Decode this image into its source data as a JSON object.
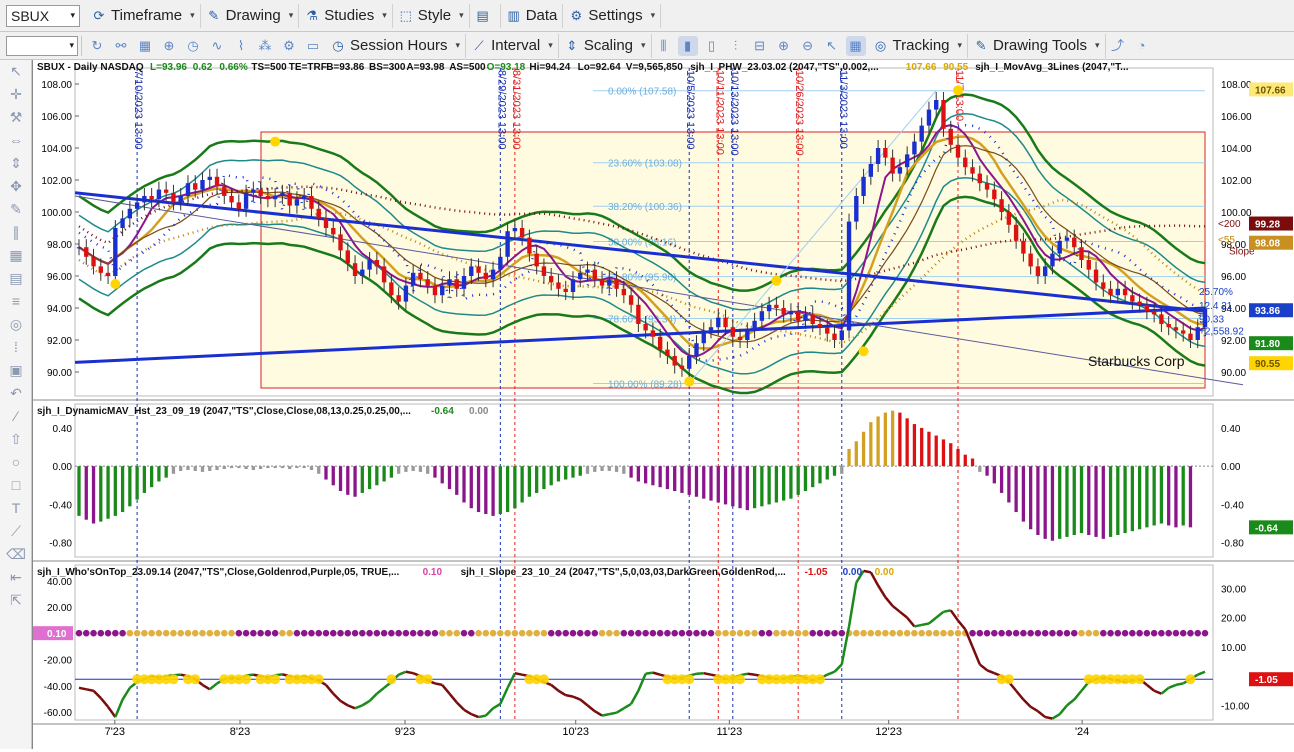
{
  "toolbar": {
    "symbol": "SBUX",
    "row1": [
      {
        "id": "timeframe",
        "label": "Timeframe",
        "icon": "timeframe-icon"
      },
      {
        "id": "drawing",
        "label": "Drawing",
        "icon": "drawing-icon"
      },
      {
        "id": "studies",
        "label": "Studies",
        "icon": "studies-icon"
      },
      {
        "id": "style",
        "label": "Style",
        "icon": "style-icon"
      },
      {
        "id": "data",
        "label": "Data",
        "icon": "data-icon"
      },
      {
        "id": "settings",
        "label": "Settings",
        "icon": "gear-icon"
      }
    ],
    "row2": [
      {
        "id": "session-hours",
        "label": "Session Hours",
        "icon": "clock-icon"
      },
      {
        "id": "interval",
        "label": "Interval",
        "icon": "interval-icon"
      },
      {
        "id": "scaling",
        "label": "Scaling",
        "icon": "scaling-icon"
      },
      {
        "id": "tracking",
        "label": "Tracking",
        "icon": "tracking-icon"
      },
      {
        "id": "drawing-tools",
        "label": "Drawing Tools",
        "icon": "drawing-tools-icon"
      }
    ]
  },
  "left_tools": [
    "cursor-icon",
    "crosshair-icon",
    "wrench-icon",
    "arrows-h-icon",
    "arrows-v-icon",
    "move-icon",
    "pen-icon",
    "bars-icon",
    "grid-icon",
    "table-icon",
    "lines-icon",
    "target-icon",
    "dots-icon",
    "image-icon",
    "undo-icon",
    "slash-icon",
    "arrow-up-icon",
    "circle-icon",
    "rectangle-icon",
    "text-icon",
    "ruler-icon",
    "erase-icon",
    "back-icon",
    "drag-icon"
  ],
  "chart_data": [
    {
      "type": "candlestick",
      "title": "SBUX - Daily NASDAQ",
      "header": [
        {
          "text": "SBUX - Daily  NASDAQ",
          "color": "#111"
        },
        {
          "text": "L=93.96",
          "color": "#1a8a1a"
        },
        {
          "text": "0.62",
          "color": "#1a8a1a"
        },
        {
          "text": "0.66%",
          "color": "#1a8a1a"
        },
        {
          "text": "TS=500",
          "color": "#111"
        },
        {
          "text": "TE=TRF",
          "color": "#111"
        },
        {
          "text": "B=93.86",
          "color": "#111"
        },
        {
          "text": "BS=300",
          "color": "#111"
        },
        {
          "text": "A=93.98",
          "color": "#111"
        },
        {
          "text": "AS=500",
          "color": "#111"
        },
        {
          "text": "O=93.18",
          "color": "#1a8a1a"
        },
        {
          "text": "Hi=94.24",
          "color": "#111"
        },
        {
          "text": "Lo=92.64",
          "color": "#111"
        },
        {
          "text": "V=9,565,850",
          "color": "#111"
        },
        {
          "text": "sjh_I_PHW_23.03.02 (2047,\"TS\",0.002,...",
          "color": "#111"
        },
        {
          "text": "107.66",
          "color": "#d9a800"
        },
        {
          "text": "90.55",
          "color": "#d9a800"
        },
        {
          "text": "sjh_I_MovAvg_3Lines (2047,\"T...",
          "color": "#111"
        }
      ],
      "ylim": [
        88.5,
        109
      ],
      "yticks": [
        90,
        92,
        94,
        96,
        98,
        100,
        102,
        104,
        106,
        108
      ],
      "ytick_labels": [
        "90.00",
        "92.00",
        "94.00",
        "96.00",
        "98.00",
        "100.00",
        "102.00",
        "104.00",
        "106.00",
        "108.00"
      ],
      "right_badges": [
        {
          "text": "107.66",
          "value": 107.66,
          "bg": "#fde87a",
          "fg": "#6b5500"
        },
        {
          "text": "99.28",
          "value": 99.28,
          "bg": "#7a0c0c",
          "fg": "#fff"
        },
        {
          "text": "98.08",
          "value": 98.08,
          "bg": "#c89020",
          "fg": "#fff"
        },
        {
          "text": "93.86",
          "value": 93.86,
          "bg": "#1a40c8",
          "fg": "#fff"
        },
        {
          "text": "91.80",
          "value": 91.8,
          "bg": "#1a8a1a",
          "fg": "#fff"
        },
        {
          "text": "90.55",
          "value": 90.55,
          "bg": "#ffd400",
          "fg": "#6b5500"
        }
      ],
      "annotations": [
        {
          "text": "<200",
          "value": 99.3,
          "color": "#7a0c0c"
        },
        {
          "text": "<55",
          "value": 98.3,
          "color": "#b8860b"
        },
        {
          "text": "Slope",
          "value": 97.6,
          "color": "#7a0c0c"
        },
        {
          "text": "25.70%",
          "value": 95.05,
          "color": "#1a40c8"
        },
        {
          "text": "12.4 21",
          "value": 94.2,
          "color": "#1a40c8"
        },
        {
          "text": "90.33",
          "value": 93.35,
          "color": "#1a40c8"
        },
        {
          "text": "+2,558.92",
          "value": 92.6,
          "color": "#1a40c8"
        },
        {
          "text": "Starbucks Corp",
          "value": 90.7,
          "color": "#111"
        }
      ],
      "fib_levels": [
        {
          "text": "0.00% (107.58)",
          "value": 107.58
        },
        {
          "text": "23.60% (103.08)",
          "value": 103.08
        },
        {
          "text": "38.20% (100.36)",
          "value": 100.36
        },
        {
          "text": "50.00% (98.16)",
          "value": 98.16
        },
        {
          "text": "61.80% (95.96)",
          "value": 95.96
        },
        {
          "text": "78.60% (93.34)",
          "value": 93.34
        },
        {
          "text": "100.00% (89.28)",
          "value": 89.28
        }
      ],
      "vlines": [
        {
          "label": "7/10/2023 13:00",
          "x": 8,
          "style": "blue"
        },
        {
          "label": "8/29/2023 13:00",
          "x": 58,
          "style": "blue"
        },
        {
          "label": "8/31/2023 13:00",
          "x": 60,
          "style": "red"
        },
        {
          "label": "10/5/2023 13:00",
          "x": 84,
          "style": "blue"
        },
        {
          "label": "10/11/2023 13:00",
          "x": 88,
          "style": "red"
        },
        {
          "label": "10/13/2023 13:00",
          "x": 90,
          "style": "blue"
        },
        {
          "label": "10/26/2023 13:00",
          "x": 99,
          "style": "red"
        },
        {
          "label": "11/3/2023 13:00",
          "x": 105,
          "style": "blue"
        },
        {
          "label": "11/7 13:00",
          "x": 121,
          "style": "red"
        }
      ],
      "close": [
        97.8,
        97.2,
        96.6,
        96.2,
        96.0,
        99.0,
        99.6,
        100.2,
        100.6,
        101.0,
        100.8,
        101.4,
        101.2,
        100.6,
        101.0,
        101.8,
        101.4,
        102.0,
        102.2,
        101.6,
        101.0,
        100.6,
        100.2,
        101.2,
        101.4,
        101.0,
        100.8,
        101.0,
        101.2,
        100.4,
        100.8,
        101.0,
        100.2,
        99.6,
        99.0,
        98.6,
        97.6,
        96.8,
        96.0,
        96.4,
        97.0,
        96.6,
        95.6,
        94.8,
        94.4,
        95.4,
        96.2,
        95.8,
        95.4,
        94.8,
        95.4,
        95.8,
        95.2,
        96.0,
        96.6,
        96.2,
        95.8,
        96.4,
        97.2,
        98.8,
        99.0,
        98.4,
        97.4,
        96.6,
        96.0,
        95.6,
        95.2,
        95.0,
        95.8,
        96.2,
        96.4,
        95.8,
        95.4,
        95.8,
        95.2,
        94.8,
        94.2,
        93.0,
        92.6,
        92.2,
        91.4,
        91.0,
        90.4,
        90.2,
        91.0,
        91.8,
        92.6,
        92.8,
        93.4,
        92.8,
        92.2,
        92.0,
        92.6,
        93.2,
        93.8,
        94.2,
        94.0,
        93.6,
        93.8,
        93.2,
        93.6,
        93.0,
        92.8,
        92.4,
        92.0,
        92.6,
        99.4,
        101.0,
        102.2,
        103.0,
        104.0,
        103.4,
        102.4,
        102.8,
        103.6,
        104.4,
        105.4,
        106.4,
        107.0,
        105.2,
        104.2,
        103.4,
        102.8,
        102.4,
        101.8,
        101.4,
        100.8,
        100.0,
        99.2,
        98.2,
        97.4,
        96.6,
        96.0,
        96.6,
        97.4,
        98.2,
        98.4,
        97.8,
        97.0,
        96.4,
        95.6,
        95.2,
        94.8,
        95.2,
        94.8,
        94.4,
        94.2,
        93.8,
        93.6,
        93.0,
        92.8,
        92.6,
        92.4,
        92.0,
        92.8,
        93.96
      ]
    },
    {
      "type": "bar",
      "title": "sjh_I_DynamicMAV_Hst_23_09_19 (2047,\"TS\",Close,Close,08,13,0.25,0.25,00,...",
      "header_values": [
        {
          "text": "-0.64",
          "color": "#1a8a1a"
        },
        {
          "text": "0.00",
          "color": "#888"
        }
      ],
      "ylim": [
        -0.95,
        0.65
      ],
      "yticks": [
        -0.8,
        -0.4,
        0.0,
        0.4
      ],
      "ytick_labels": [
        "-0.80",
        "-0.40",
        "0.00",
        "0.40"
      ],
      "last_value_badge": {
        "text": "-0.64",
        "bg": "#1a8a1a",
        "fg": "#fff"
      },
      "values": [
        -0.52,
        -0.56,
        -0.6,
        -0.58,
        -0.55,
        -0.52,
        -0.48,
        -0.42,
        -0.35,
        -0.28,
        -0.22,
        -0.16,
        -0.12,
        -0.08,
        -0.05,
        -0.04,
        -0.05,
        -0.06,
        -0.05,
        -0.04,
        -0.03,
        -0.02,
        -0.02,
        -0.03,
        -0.04,
        -0.03,
        -0.02,
        -0.02,
        -0.02,
        -0.03,
        -0.02,
        -0.02,
        -0.04,
        -0.08,
        -0.14,
        -0.2,
        -0.26,
        -0.3,
        -0.32,
        -0.28,
        -0.24,
        -0.2,
        -0.16,
        -0.12,
        -0.08,
        -0.06,
        -0.05,
        -0.06,
        -0.08,
        -0.12,
        -0.18,
        -0.24,
        -0.3,
        -0.38,
        -0.44,
        -0.48,
        -0.5,
        -0.52,
        -0.5,
        -0.48,
        -0.44,
        -0.38,
        -0.32,
        -0.28,
        -0.24,
        -0.2,
        -0.16,
        -0.14,
        -0.12,
        -0.1,
        -0.08,
        -0.06,
        -0.05,
        -0.05,
        -0.06,
        -0.08,
        -0.12,
        -0.16,
        -0.18,
        -0.2,
        -0.22,
        -0.24,
        -0.26,
        -0.28,
        -0.3,
        -0.32,
        -0.34,
        -0.36,
        -0.38,
        -0.4,
        -0.42,
        -0.44,
        -0.46,
        -0.44,
        -0.42,
        -0.4,
        -0.38,
        -0.36,
        -0.34,
        -0.3,
        -0.26,
        -0.22,
        -0.18,
        -0.14,
        -0.1,
        -0.08,
        0.18,
        0.26,
        0.36,
        0.46,
        0.52,
        0.56,
        0.58,
        0.56,
        0.5,
        0.44,
        0.4,
        0.36,
        0.32,
        0.28,
        0.24,
        0.18,
        0.12,
        0.08,
        -0.06,
        -0.1,
        -0.18,
        -0.28,
        -0.38,
        -0.48,
        -0.58,
        -0.66,
        -0.72,
        -0.76,
        -0.78,
        -0.76,
        -0.74,
        -0.72,
        -0.7,
        -0.72,
        -0.74,
        -0.76,
        -0.74,
        -0.72,
        -0.7,
        -0.68,
        -0.66,
        -0.64,
        -0.62,
        -0.6,
        -0.62,
        -0.64,
        -0.62,
        -0.64
      ],
      "colors_legend": {
        "positive_up": "#d4a020",
        "positive": "#dd1111",
        "negative_up": "#1a8a1a",
        "negative": "#8b168b",
        "flat": "#999999"
      }
    },
    {
      "type": "line",
      "title": "sjh_I_Who'sOnTop_23.09.14 (2047,\"TS\",Close,Goldenrod,Purple,05, TRUE,...",
      "header_values": [
        {
          "text": "0.10",
          "color": "#e040a0"
        }
      ],
      "title2": "sjh_I_Slope_23_10_24 (2047,\"TS\",5,0,03,03,DarkGreen,GoldenRod,...",
      "header_values2": [
        {
          "text": "-1.05",
          "color": "#dd1111"
        },
        {
          "text": "0.00",
          "color": "#1a40c8"
        },
        {
          "text": "0.00",
          "color": "#d9a800"
        }
      ],
      "ylim_left": [
        -66,
        52
      ],
      "yticks_left": [
        -60,
        -40,
        -20,
        20,
        40
      ],
      "ytick_labels_left": [
        "-60.00",
        "-40.00",
        "-20.00",
        "20.00",
        "40.00"
      ],
      "left_badge": {
        "text": "0.10",
        "bg": "#e070d0",
        "fg": "#fff"
      },
      "ylim_right": [
        -15,
        38
      ],
      "yticks_right": [
        -10,
        10,
        20,
        30
      ],
      "ytick_labels_right": [
        "-10.00",
        "10.00",
        "20.00",
        "30.00"
      ],
      "right_badge": {
        "text": "-1.05",
        "bg": "#dd1111",
        "fg": "#fff"
      },
      "slope": [
        -4.0,
        -4.5,
        -5.0,
        -7.5,
        -10.5,
        -14.0,
        -8.0,
        -4.0,
        -2.0,
        -1.0,
        0.0,
        -0.5,
        0.0,
        0.3,
        0.5,
        0.0,
        -1.0,
        -3.0,
        -4.5,
        -2.5,
        -1.0,
        -0.5,
        -1.0,
        0.2,
        0.5,
        0.0,
        -0.5,
        0.3,
        0.6,
        0.0,
        -0.5,
        0.0,
        -0.8,
        -1.5,
        -3.0,
        -6.0,
        -8.5,
        -10.0,
        -11.0,
        -10.0,
        -8.5,
        -6.0,
        -4.0,
        -2.0,
        0.5,
        1.5,
        1.0,
        0.0,
        -1.5,
        -2.5,
        -3.0,
        -6.0,
        -9.0,
        -11.5,
        -13.0,
        -14.0,
        -13.5,
        -11.0,
        -9.5,
        -4.0,
        1.0,
        0.5,
        0.0,
        -1.0,
        -2.0,
        -3.0,
        -5.0,
        -6.5,
        -7.0,
        -8.0,
        -10.0,
        -12.0,
        -13.5,
        -13.0,
        -12.5,
        -11.0,
        -9.5,
        -5.0,
        0.8,
        1.2,
        0.5,
        -0.2,
        -0.8,
        -0.5,
        0.2,
        0.8,
        1.0,
        0.5,
        0.0,
        -1.0,
        -0.5,
        0.3,
        0.8,
        0.5,
        0.0,
        -0.5,
        -1.0,
        -0.8,
        -0.3,
        0.2,
        -0.5,
        -1.5,
        -0.8,
        0.5,
        1.5,
        4.0,
        17.0,
        32.0,
        36.0,
        35.5,
        31.0,
        27.0,
        24.0,
        22.0,
        20.0,
        17.0,
        17.5,
        18.0,
        20.0,
        22.0,
        22.5,
        19.0,
        16.0,
        10.0,
        4.0,
        2.0,
        1.0,
        0.0,
        -2.0,
        -5.0,
        -8.0,
        -10.5,
        -12.0,
        -14.0,
        -14.5,
        -13.0,
        -10.0,
        -8.0,
        -5.0,
        -2.0,
        -1.0,
        -0.5,
        -1.0,
        -1.5,
        -2.0,
        -1.5,
        -1.0,
        -3.0,
        -5.0,
        -6.0,
        -4.0,
        -3.0,
        -2.5,
        -1.0,
        0.5,
        1.5,
        0.5,
        -2.0,
        -4.0,
        -7.0,
        -9.0,
        -9.5,
        -8.0,
        -6.5,
        -5.0,
        -4.0,
        -3.5,
        -4.0,
        -5.0,
        -5.5,
        -4.0,
        -1.05
      ]
    }
  ],
  "x_axis": {
    "labels": [
      "7'23",
      "8'23",
      "9'23",
      "10'23",
      "11'23",
      "12'23",
      "'24"
    ],
    "positions": [
      0.035,
      0.145,
      0.29,
      0.44,
      0.575,
      0.715,
      0.885
    ]
  },
  "chart_title": "Starbucks Corp"
}
